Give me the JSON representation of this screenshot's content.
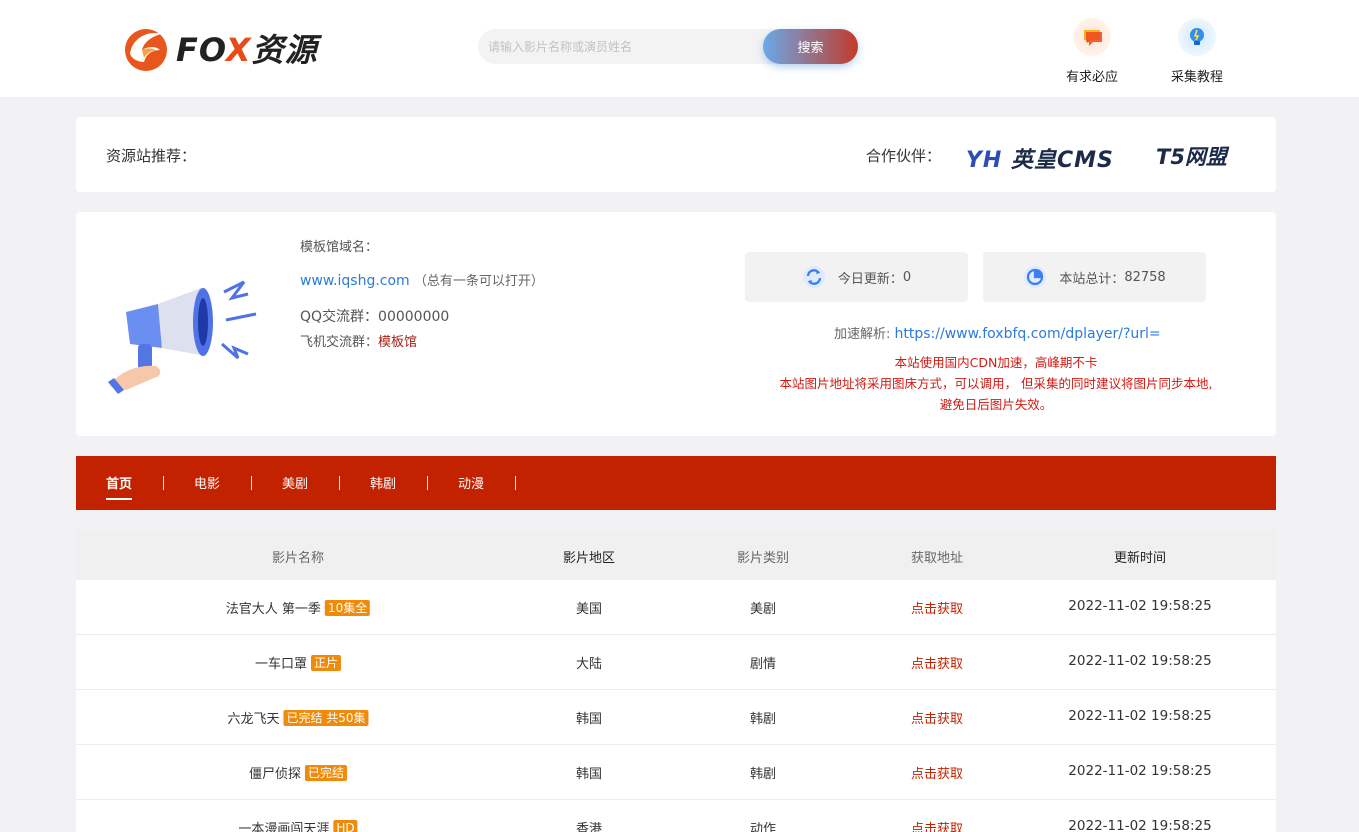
{
  "header": {
    "logo_brand_a": "FO",
    "logo_brand_x": "X",
    "logo_brand_b": "资源",
    "search_placeholder": "请输入影片名称或演员姓名",
    "search_button": "搜索",
    "request_label": "有求必应",
    "tutorial_label": "采集教程"
  },
  "recommend": {
    "title": "资源站推荐：",
    "partner_label": "合作伙伴：",
    "partner1_a": "YH",
    "partner1_b": " 英皇CMS",
    "partner2": "T5网盟"
  },
  "info": {
    "domain_label": "模板馆域名：",
    "domain_url": "www.iqshg.com",
    "domain_note": "（总有一条可以打开）",
    "qq_label": "QQ交流群：",
    "qq_value": "00000000",
    "tg_label": "飞机交流群：",
    "tg_value": "模板馆",
    "today_label": "今日更新：",
    "today_value": "0",
    "total_label": "本站总计：",
    "total_value": "82758",
    "accel_label": "加速解析: ",
    "accel_url": "https://www.foxbfq.com/dplayer/?url=",
    "notice1": "本站使用国内CDN加速，高峰期不卡",
    "notice2": "本站图片地址将采用图床方式，可以调用， 但采集的同时建议将图片同步本地,",
    "notice3": "避免日后图片失效。"
  },
  "nav": {
    "items": [
      "首页",
      "电影",
      "美剧",
      "韩剧",
      "动漫"
    ]
  },
  "table": {
    "headers": [
      "影片名称",
      "影片地区",
      "影片类别",
      "获取地址",
      "更新时间"
    ],
    "rows": [
      {
        "name": "法官大人 第一季",
        "badge": "10集全",
        "region": "美国",
        "category": "美剧",
        "link": "点击获取",
        "time": "2022-11-02 19:58:25"
      },
      {
        "name": "一车口罩",
        "badge": "正片",
        "region": "大陆",
        "category": "剧情",
        "link": "点击获取",
        "time": "2022-11-02 19:58:25"
      },
      {
        "name": "六龙飞天",
        "badge": "已完结 共50集",
        "region": "韩国",
        "category": "韩剧",
        "link": "点击获取",
        "time": "2022-11-02 19:58:25"
      },
      {
        "name": "僵尸侦探",
        "badge": "已完结",
        "region": "韩国",
        "category": "韩剧",
        "link": "点击获取",
        "time": "2022-11-02 19:58:25"
      },
      {
        "name": "一本漫画闯天涯",
        "badge": "HD",
        "region": "香港",
        "category": "动作",
        "link": "点击获取",
        "time": "2022-11-02 19:58:25"
      }
    ]
  },
  "colors": {
    "brand_red": "#c22200",
    "badge_orange": "#f08a0a",
    "link_blue": "#2b7bd9"
  }
}
